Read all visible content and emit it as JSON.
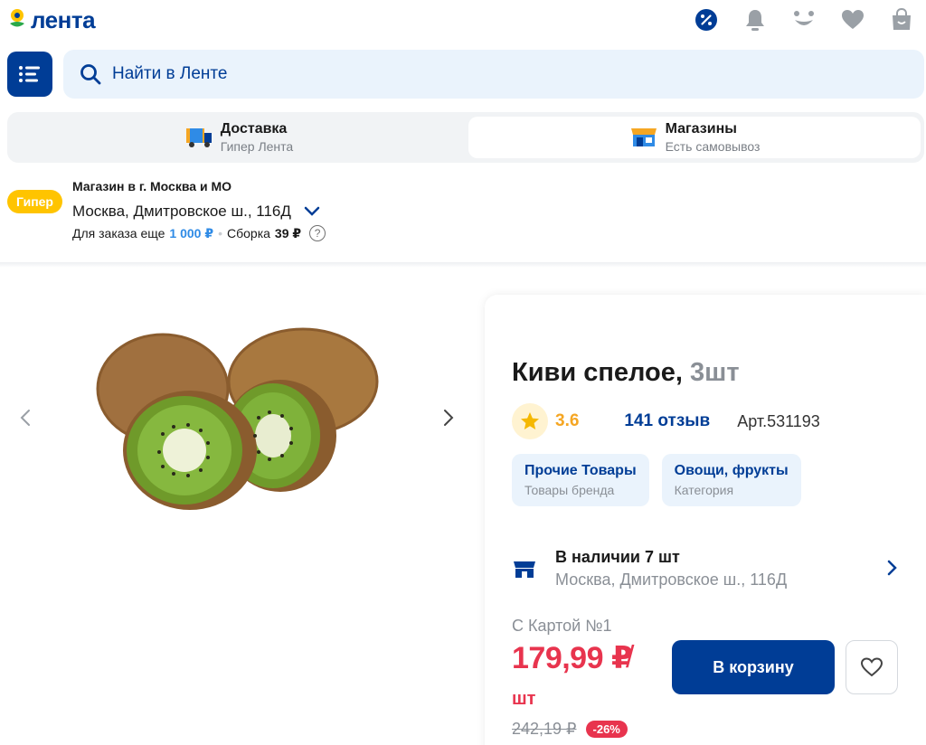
{
  "header": {
    "logo_text": "лента",
    "icons": [
      "discount-icon",
      "bell-icon",
      "smile-icon",
      "heart-icon",
      "cart-icon"
    ]
  },
  "search": {
    "placeholder": "Найти в Ленте"
  },
  "delivery_toggle": {
    "options": [
      {
        "title": "Доставка",
        "subtitle": "Гипер Лента",
        "active": false
      },
      {
        "title": "Магазины",
        "subtitle": "Есть самовывоз",
        "active": true
      }
    ]
  },
  "store": {
    "badge": "Гипер",
    "caption": "Магазин в г. Москва и МО",
    "address": "Москва, Дмитровское ш., 116Д",
    "order_label": "Для заказа еще",
    "order_amount": "1 000 ₽",
    "assembly_label": "Сборка",
    "assembly_price": "39 ₽",
    "help": "?"
  },
  "product": {
    "name": "Киви спелое,",
    "quantity": "3шт",
    "rating": "3.6",
    "reviews": "141 отзыв",
    "article": "Арт.531193",
    "chips": [
      {
        "title": "Прочие Товары",
        "subtitle": "Товары бренда"
      },
      {
        "title": "Овощи, фрукты",
        "subtitle": "Категория"
      }
    ],
    "availability": {
      "title": "В наличии 7 шт",
      "address": "Москва, Дмитровское ш., 116Д"
    },
    "card_label": "С Картой №1",
    "price": "179,99 ₽",
    "slash": "/",
    "unit": "шт",
    "old_price": "242,19 ₽",
    "discount": "-26%",
    "cart_button": "В корзину"
  },
  "colors": {
    "brand_blue": "#003d96",
    "accent_yellow": "#ffc400",
    "price_red": "#e8344e",
    "light_blue_bg": "#eaf3fc"
  }
}
